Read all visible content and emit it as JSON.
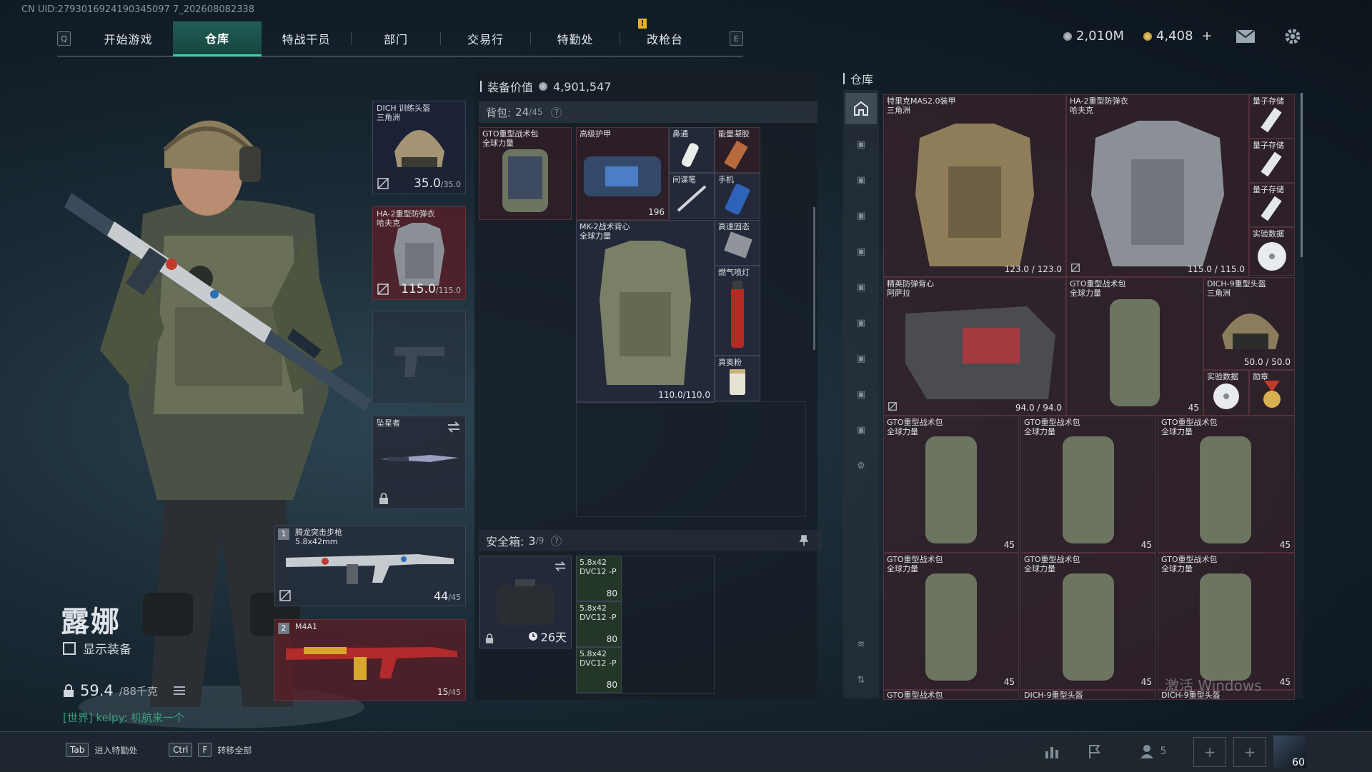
{
  "uid": "CN UID:2793016924190345097 7_202608082338",
  "topnav": {
    "left_key": "Q",
    "right_key": "E",
    "tabs": [
      "开始游戏",
      "仓库",
      "特战干员",
      "部门",
      "交易行",
      "特勤处",
      "改枪台"
    ],
    "active_tab": "仓库",
    "alert_badge": "!"
  },
  "currency": {
    "coins": "2,010M",
    "tokens": "4,408",
    "plus": "+"
  },
  "character": {
    "name": "露娜",
    "show_gear_label": "显示装备",
    "weight": "59.4",
    "weight_max": "/88千克",
    "chat_channel": "[世界]",
    "chat_message": "kelpy: 机航来一个"
  },
  "equipment": {
    "helmet": {
      "label": "DICH 训练头盔",
      "sub": "三角洲",
      "dur": "35.0",
      "dur_max": "/35.0"
    },
    "armor": {
      "label": "HA-2重型防弹衣",
      "sub": "哈夫克",
      "dur": "115.0",
      "dur_max": "/115.0"
    },
    "melee": {
      "label": "坠星者"
    },
    "primary": {
      "slot": "1",
      "name": "腾龙突击步枪",
      "ammo_type": "5.8x42mm",
      "ammo": "44",
      "ammo_max": "/45"
    },
    "secondary": {
      "slot": "2",
      "name": "M4A1",
      "ammo": "15",
      "ammo_max": "/45"
    }
  },
  "backpack_panel": {
    "gear_value_label": "装备价值",
    "gear_value": "4,901,547",
    "backpack_label": "背包:",
    "backpack_used": "24",
    "backpack_max": "/45",
    "items": [
      {
        "name": "GTO重型战术包",
        "sub": "全球力量"
      },
      {
        "name": "高级护甲",
        "count": "196"
      },
      {
        "name": "鼻通"
      },
      {
        "name": "能量凝胶"
      },
      {
        "name": "间谍笔"
      },
      {
        "name": "手机"
      },
      {
        "name": "MK-2战术背心",
        "sub": "全球力量",
        "dur": "110.0/110.0"
      },
      {
        "name": "高速固态"
      },
      {
        "name": "燃气喷灯"
      },
      {
        "name": "真奥粉"
      }
    ]
  },
  "safebox": {
    "label": "安全箱:",
    "used": "3",
    "max": "/9",
    "days": "26天",
    "ammo": [
      {
        "name": "5.8x42",
        "sub": "DVC12 -P",
        "count": "80"
      },
      {
        "name": "5.8x42",
        "sub": "DVC12 -P",
        "count": "80"
      },
      {
        "name": "5.8x42",
        "sub": "DVC12 -P",
        "count": "80"
      }
    ]
  },
  "storage": {
    "title": "仓库",
    "items": [
      {
        "name": "特里克MAS2.0装甲",
        "sub": "三角洲",
        "dur": "123.0 / 123.0"
      },
      {
        "name": "HA-2重型防弹衣",
        "sub": "哈夫克",
        "dur": "115.0 / 115.0"
      },
      {
        "name": "量子存储"
      },
      {
        "name": "量子存储"
      },
      {
        "name": "量子存储"
      },
      {
        "name": "实验数据"
      },
      {
        "name": "精英防弹背心",
        "sub": "阿萨拉",
        "dur": "94.0 / 94.0"
      },
      {
        "name": "GTO重型战术包",
        "sub": "全球力量",
        "count": "45"
      },
      {
        "name": "DICH-9重型头盔",
        "sub": "三角洲",
        "dur": "50.0 / 50.0"
      },
      {
        "name": "实验数据"
      },
      {
        "name": "勋章"
      },
      {
        "name": "GTO重型战术包",
        "sub": "全球力量",
        "count": "45"
      },
      {
        "name": "GTO重型战术包",
        "sub": "全球力量",
        "count": "45"
      },
      {
        "name": "GTO重型战术包",
        "sub": "全球力量",
        "count": "45"
      },
      {
        "name": "GTO重型战术包",
        "sub": "全球力量",
        "count": "45"
      },
      {
        "name": "GTO重型战术包",
        "sub": "全球力量",
        "count": "45"
      },
      {
        "name": "GTO重型战术包",
        "sub": "全球力量",
        "count": "45"
      },
      {
        "name": "GTO重型战术包"
      },
      {
        "name": "DICH-9重型头盔"
      },
      {
        "name": "DICH-9重型头盔"
      }
    ]
  },
  "bottom": {
    "tab_key": "Tab",
    "tab_label": "进入特勤处",
    "ctrl_key": "Ctrl",
    "f_key": "F",
    "transfer_label": "转移全部",
    "friends_count": "5",
    "avatar_level": "60"
  },
  "watermark": "激活 Windows"
}
